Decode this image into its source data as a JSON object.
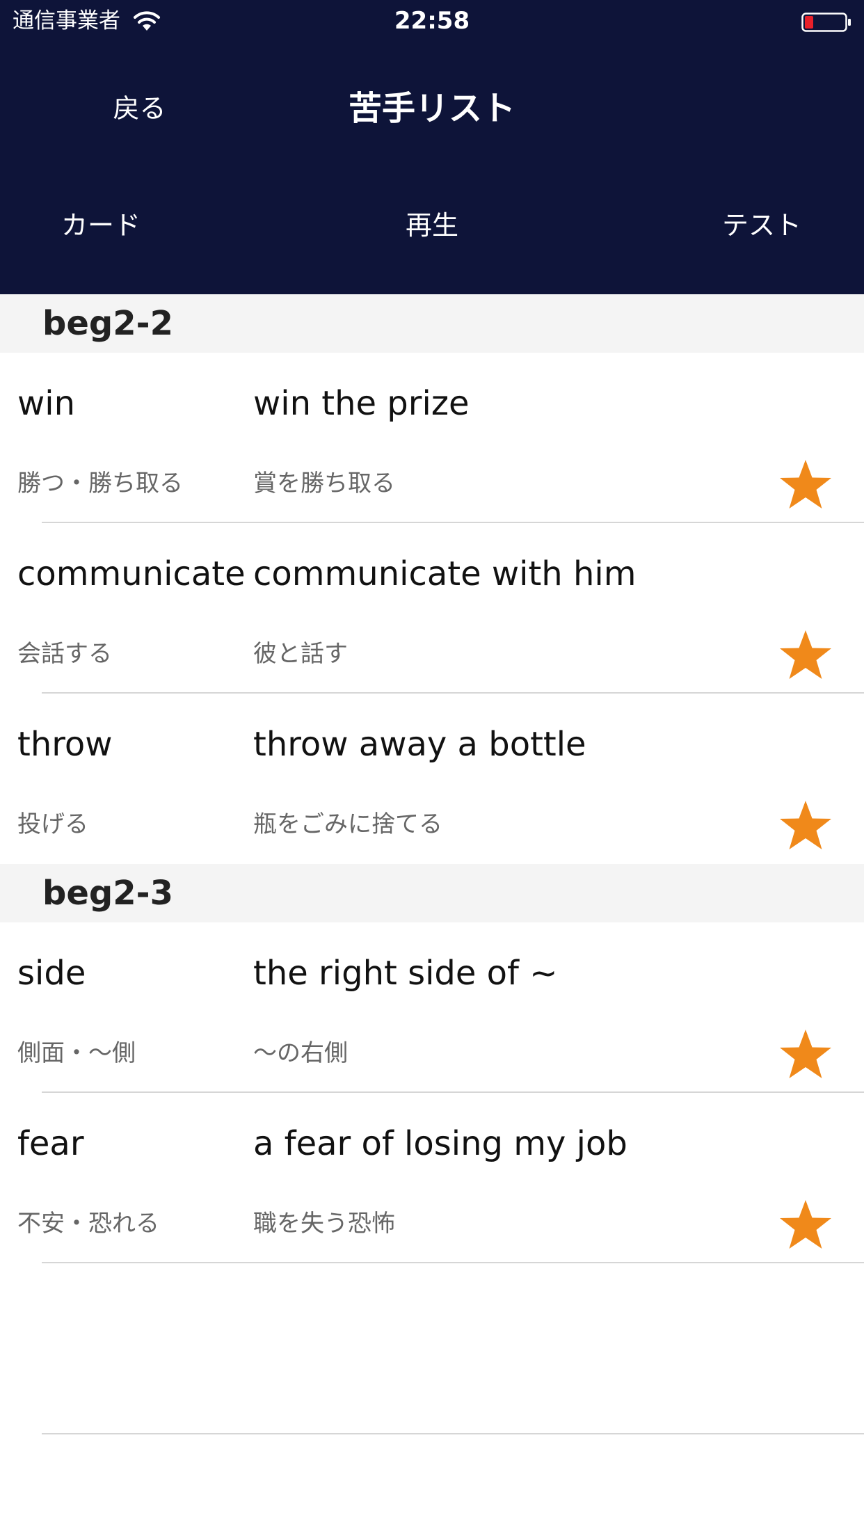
{
  "status_bar": {
    "carrier": "通信事業者",
    "time": "22:58",
    "wifi_icon": "wifi-icon",
    "battery_icon": "battery-low-icon",
    "battery_color": "#e8202a"
  },
  "nav": {
    "back_label": "戻る",
    "title": "苦手リスト"
  },
  "toolbar": {
    "card_label": "カード",
    "play_label": "再生",
    "test_label": "テスト"
  },
  "colors": {
    "header_bg": "#0e1439",
    "star": "#f0891a",
    "section_bg": "#f4f4f4"
  },
  "sections": [
    {
      "title": "beg2-2",
      "items": [
        {
          "word": "win",
          "phrase": "win the prize",
          "meaning": "勝つ・勝ち取る",
          "phrase_meaning": "賞を勝ち取る",
          "starred": true
        },
        {
          "word": "communicate",
          "phrase": "communicate with him",
          "meaning": "会話する",
          "phrase_meaning": "彼と話す",
          "starred": true
        },
        {
          "word": "throw",
          "phrase": "throw away a bottle",
          "meaning": "投げる",
          "phrase_meaning": "瓶をごみに捨てる",
          "starred": true
        }
      ]
    },
    {
      "title": "beg2-3",
      "items": [
        {
          "word": "side",
          "phrase": "the right side of ~",
          "meaning": "側面・〜側",
          "phrase_meaning": "〜の右側",
          "starred": true
        },
        {
          "word": "fear",
          "phrase": "a fear of losing my job",
          "meaning": "不安・恐れる",
          "phrase_meaning": "職を失う恐怖",
          "starred": true
        }
      ]
    }
  ]
}
